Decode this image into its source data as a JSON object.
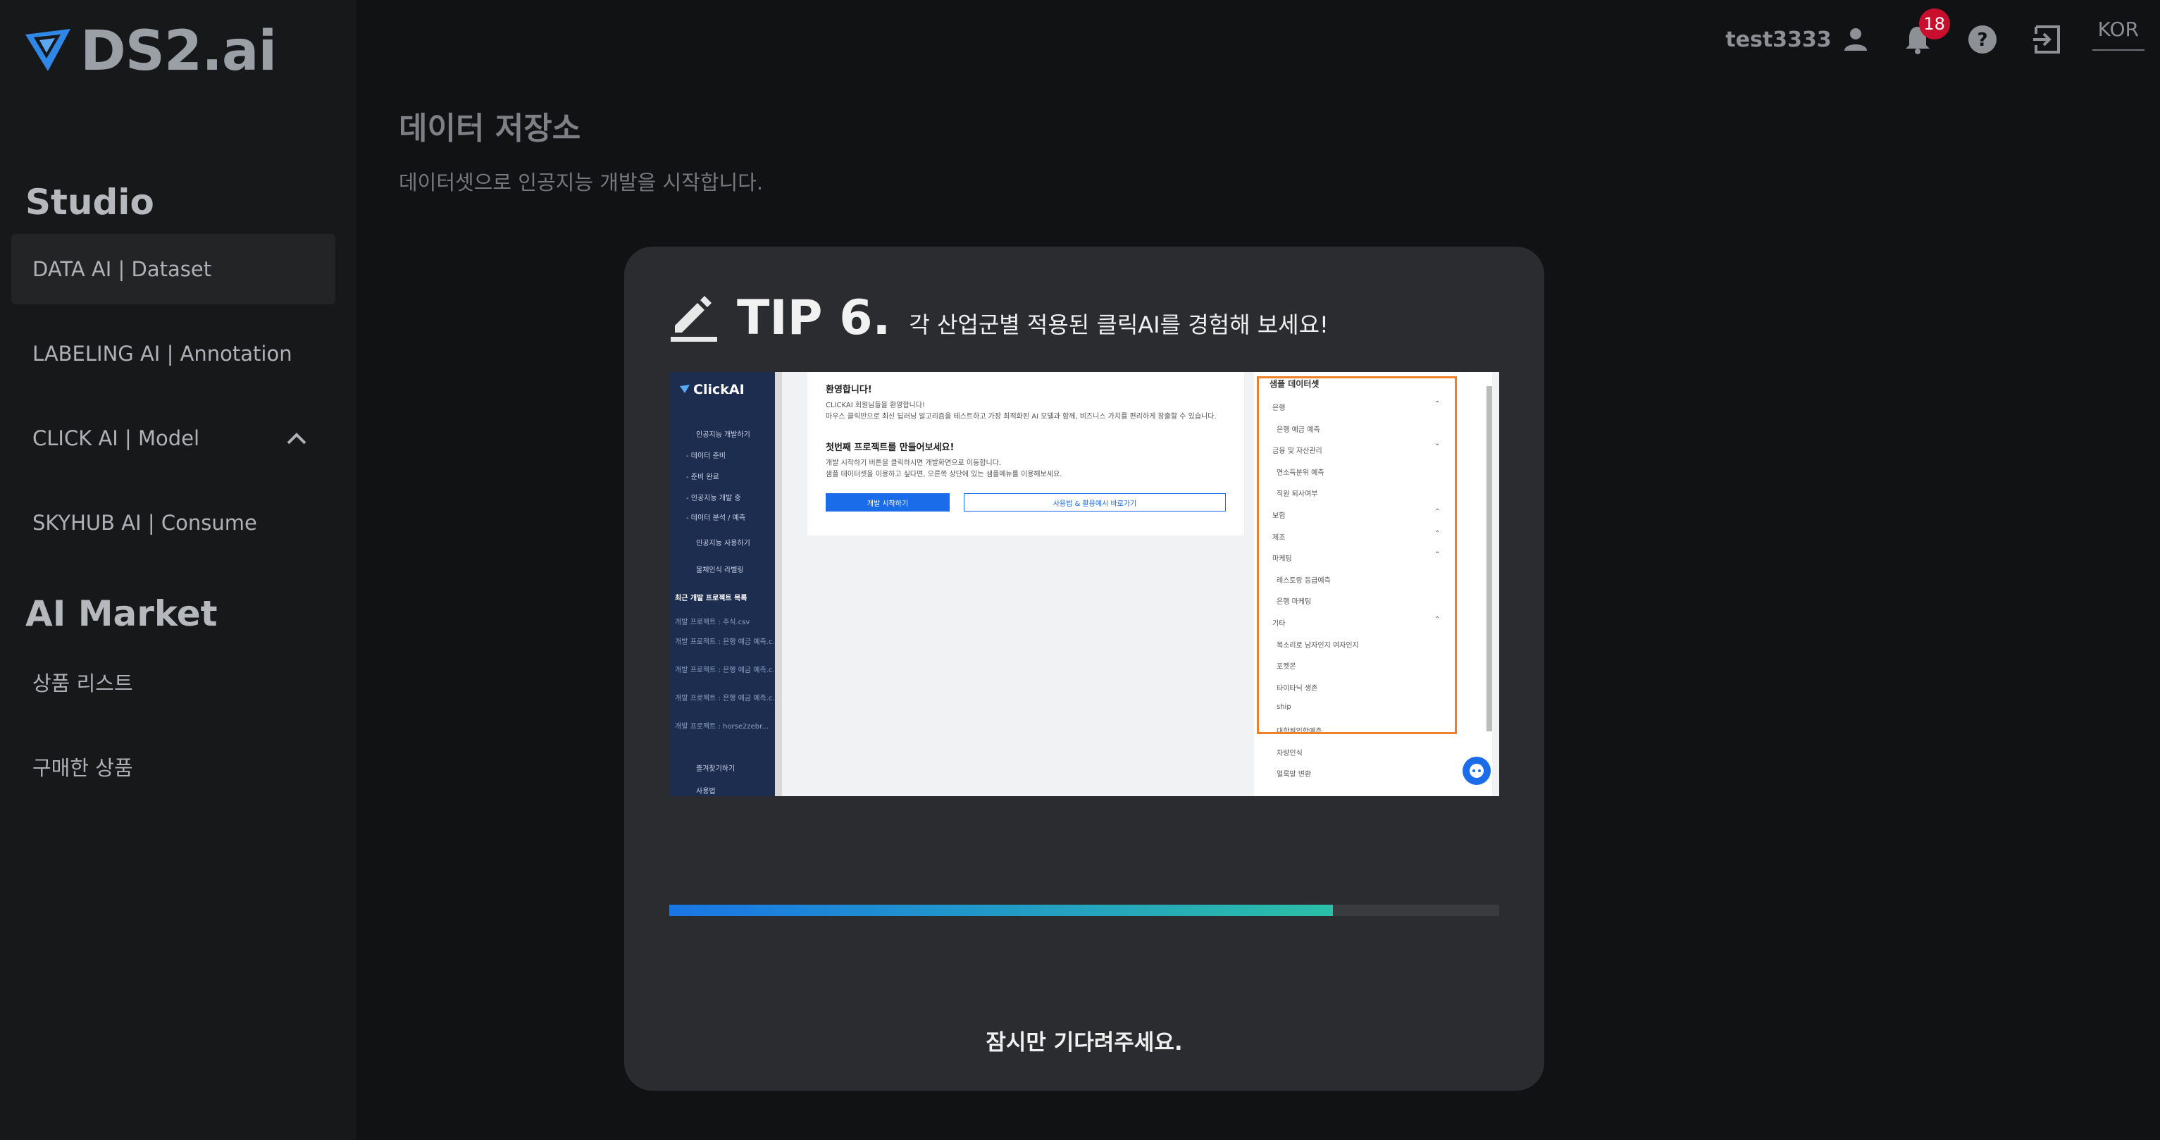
{
  "brand": {
    "logo_text": "DS2.ai"
  },
  "sidebar": {
    "sections": [
      {
        "title": "Studio",
        "items": [
          {
            "label": "DATA AI | Dataset",
            "active": true
          },
          {
            "label": "LABELING AI | Annotation"
          },
          {
            "label": "CLICK AI | Model",
            "expanded": true
          },
          {
            "label": "SKYHUB AI | Consume"
          }
        ]
      },
      {
        "title": "AI Market",
        "items": [
          {
            "label": "상품 리스트"
          },
          {
            "label": "구매한 상품"
          }
        ]
      }
    ]
  },
  "header": {
    "username": "test3333",
    "notification_count": "18",
    "language": "KOR",
    "icons": [
      "user-icon",
      "bell-icon",
      "help-icon",
      "logout-icon"
    ]
  },
  "page": {
    "title": "데이터 저장소",
    "subtitle": "데이터셋으로 인공지능 개발을 시작합니다."
  },
  "modal": {
    "tip_label": "TIP 6.",
    "tip_text": "각 산업군별 적용된 클릭AI를 경험해 보세요!",
    "progress_percent": 80,
    "wait_text": "잠시만 기다려주세요.",
    "preview": {
      "app_name": "ClickAI",
      "welcome_title": "환영합니다!",
      "welcome_line1": "CLICKAI 회원님들을 환영합니다!",
      "welcome_line2": "마우스 클릭만으로 최신 딥러닝 알고리즘을 테스트하고 가장 최적화된 AI 모델과 함께, 비즈니스 가치를 편리하게 창출할 수 있습니다.",
      "project_title": "첫번째 프로젝트를 만들어보세요!",
      "project_line1": "개발 시작하기 버튼을 클릭하시면 개발화면으로 이동합니다.",
      "project_line2": "샘플 데이터셋을 이용하고 싶다면, 오른쪽 상단에 있는 샘플메뉴를 이용해보세요.",
      "start_button": "개발 시작하기",
      "sample_button": "사용법 & 활용예시 바로가기",
      "side_menu": [
        "인공지능 개발하기",
        "- 데이터 준비",
        "- 준비 완료",
        "- 인공지능 개발 중",
        "- 데이터 분석 / 예측",
        "인공지능 사용하기",
        "물체인식 라벨링"
      ],
      "recent_title": "최근 개발 프로젝트 목록",
      "recent_items": [
        "개발 프로젝트 : 주식.csv",
        "개발 프로젝트 : 은행 예금 예측.c...",
        "개발 프로젝트 : 은행 예금 예측.c...",
        "개발 프로젝트 : 은행 예금 예측.c...",
        "개발 프로젝트 : horse2zebr..."
      ],
      "side_bottom": [
        "즐겨찾기하기",
        "사용법"
      ],
      "sample_title": "샘플 데이터셋",
      "sample_items": [
        "은행",
        "은행 예금 예측",
        "금융 및 자산관리",
        "연소득분위 예측",
        "직원 퇴사여부",
        "보험",
        "제조",
        "마케팅",
        "레스토랑 등급예측",
        "은행 마케팅",
        "기타",
        "목소리로 남자인지 여자인지",
        "포켓몬",
        "타이타닉 생존",
        "ship",
        "대학원입학예측",
        "차량인식",
        "얼룩말 변환"
      ]
    }
  }
}
